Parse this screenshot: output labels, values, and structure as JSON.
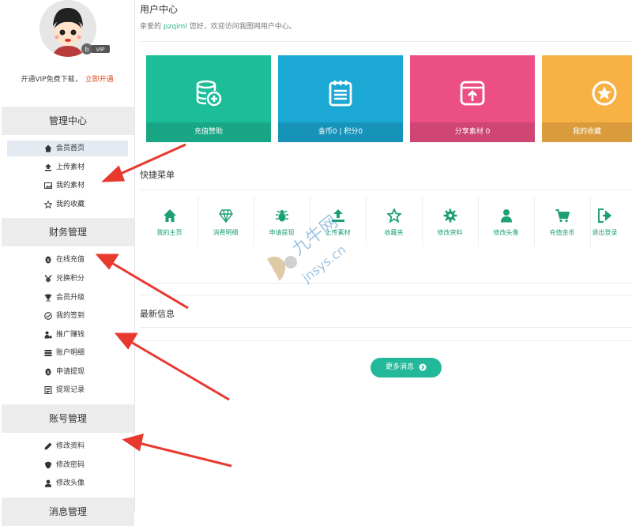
{
  "sidebar": {
    "vip_badge": "VIP",
    "vip_promo_text": "开通VIP免费下载，",
    "vip_promo_link": "立即开通",
    "sections": [
      {
        "title": "管理中心",
        "items": [
          {
            "label": "会员首页",
            "icon": "home-icon",
            "active": true
          },
          {
            "label": "上传素材",
            "icon": "upload-icon"
          },
          {
            "label": "我的素材",
            "icon": "image-icon"
          },
          {
            "label": "我的收藏",
            "icon": "star-icon"
          }
        ]
      },
      {
        "title": "财务管理",
        "items": [
          {
            "label": "在线充值",
            "icon": "coin-icon"
          },
          {
            "label": "兑换积分",
            "icon": "yen-icon"
          },
          {
            "label": "会员升级",
            "icon": "trophy-icon"
          },
          {
            "label": "我的签到",
            "icon": "check-circle-icon"
          },
          {
            "label": "推广赚钱",
            "icon": "user-coin-icon"
          },
          {
            "label": "账户明细",
            "icon": "list-icon"
          },
          {
            "label": "申请提现",
            "icon": "withdraw-icon"
          },
          {
            "label": "提现记录",
            "icon": "record-icon"
          }
        ]
      },
      {
        "title": "账号管理",
        "items": [
          {
            "label": "修改资料",
            "icon": "pencil-icon"
          },
          {
            "label": "修改密码",
            "icon": "shield-icon"
          },
          {
            "label": "修改头像",
            "icon": "user-icon"
          }
        ]
      },
      {
        "title": "消息管理",
        "items": []
      }
    ]
  },
  "main": {
    "title": "用户中心",
    "welcome_prefix": "亲爱的",
    "username": "pzqiml",
    "welcome_suffix": "您好，欢迎访问我图网用户中心。",
    "cards": [
      {
        "label": "充值赞助",
        "color": "#1cbd98",
        "icon": "database-plus-icon"
      },
      {
        "label": "金币0 | 积分0",
        "color": "#1ba8d4",
        "icon": "notepad-icon"
      },
      {
        "label": "分享素材 0",
        "color": "#ec4f83",
        "icon": "share-upload-icon"
      },
      {
        "label": "我的收藏",
        "color": "#f8b144",
        "icon": "star-circle-icon"
      }
    ],
    "quick_title": "快捷菜单",
    "quick": [
      {
        "label": "我的主页",
        "icon": "home-icon"
      },
      {
        "label": "消费明细",
        "icon": "diamond-icon"
      },
      {
        "label": "申请提现",
        "icon": "bug-icon"
      },
      {
        "label": "上传素材",
        "icon": "upload-icon"
      },
      {
        "label": "收藏夹",
        "icon": "star-icon"
      },
      {
        "label": "修改资料",
        "icon": "gear-icon"
      },
      {
        "label": "修改头像",
        "icon": "person-icon"
      },
      {
        "label": "充值金币",
        "icon": "cart-icon"
      },
      {
        "label": "退出登录",
        "icon": "signout-icon"
      }
    ],
    "news_title": "最新信息",
    "more_button": "更多消息"
  },
  "watermark": {
    "text1": "九牛网",
    "text2": "jnsys.cn"
  },
  "colors": {
    "accent": "#23b89a",
    "arrow": "#e8392f"
  }
}
